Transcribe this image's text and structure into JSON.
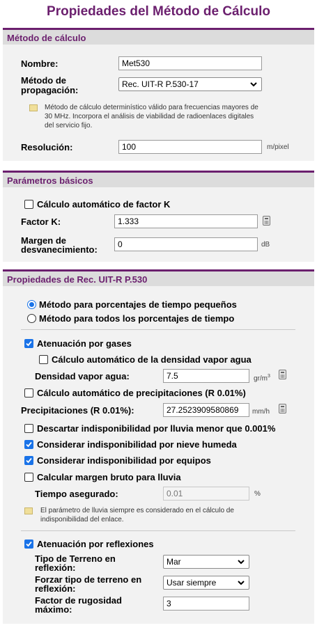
{
  "page_title": "Propiedades del Método de Cálculo",
  "metodo": {
    "header": "Método de cálculo",
    "nombre_label": "Nombre:",
    "nombre_value": "Met530",
    "propagacion_label_1": "Método de",
    "propagacion_label_2": "propagación:",
    "propagacion_value": "Rec. UIT-R P.530-17",
    "note_1": "Método de cálculo determinístico válido para frecuencias mayores de",
    "note_2": "30 MHz. Incorpora el análisis de viabilidad de radioenlaces digitales",
    "note_3": "del servicio fijo.",
    "resolucion_label": "Resolución:",
    "resolucion_value": "100",
    "resolucion_unit": "m/pixel"
  },
  "basicos": {
    "header": "Parámetros básicos",
    "auto_k_label": "Cálculo automático de factor K",
    "auto_k_checked": false,
    "factor_k_label": "Factor K:",
    "factor_k_value": "1.333",
    "margen_label_1": "Margen de",
    "margen_label_2": "desvanecimiento:",
    "margen_value": "0",
    "margen_unit": "dB"
  },
  "rec530": {
    "header": "Propiedades de Rec. UIT-R P.530",
    "radio_pequenos": "Método para porcentajes de tiempo pequeños",
    "radio_todos": "Método para todos los porcentajes de tiempo",
    "selected_method": "pequenos",
    "aten_gases_label": "Atenuación por gases",
    "aten_gases_checked": true,
    "auto_densidad_label": "Cálculo automático de la densidad vapor agua",
    "auto_densidad_checked": false,
    "densidad_label": "Densidad vapor agua:",
    "densidad_value": "7.5",
    "densidad_unit": "gr/m",
    "densidad_unit_sup": "3",
    "auto_precip_label": "Cálculo automático de precipitaciones (R 0.01%)",
    "auto_precip_checked": false,
    "precip_label": "Precipitaciones (R 0.01%):",
    "precip_value": "27.2523909580869",
    "precip_unit": "mm/h",
    "descartar_label": "Descartar indisponibilidad por lluvia menor que 0.001%",
    "descartar_checked": false,
    "nieve_label": "Considerar indisponibilidad por nieve humeda",
    "nieve_checked": true,
    "equipos_label": "Considerar indisponibilidad por equipos",
    "equipos_checked": true,
    "margen_bruto_label": "Calcular margen bruto para lluvia",
    "margen_bruto_checked": false,
    "tiempo_label": "Tiempo asegurado:",
    "tiempo_value": "0.01",
    "tiempo_unit": "%",
    "note_1": "El parámetro de lluvia siempre es considerado en el cálculo de",
    "note_2": "indisponibilidad del enlace.",
    "reflex_label": "Atenuación por reflexiones",
    "reflex_checked": true,
    "terreno_label_1": "Tipo de Terreno en",
    "terreno_label_2": "reflexión:",
    "terreno_value": "Mar",
    "forzar_label_1": "Forzar tipo de terreno en",
    "forzar_label_2": "reflexión:",
    "forzar_value": "Usar siempre",
    "rugosidad_label_1": "Factor de rugosidad",
    "rugosidad_label_2": "máximo:",
    "rugosidad_value": "3"
  }
}
